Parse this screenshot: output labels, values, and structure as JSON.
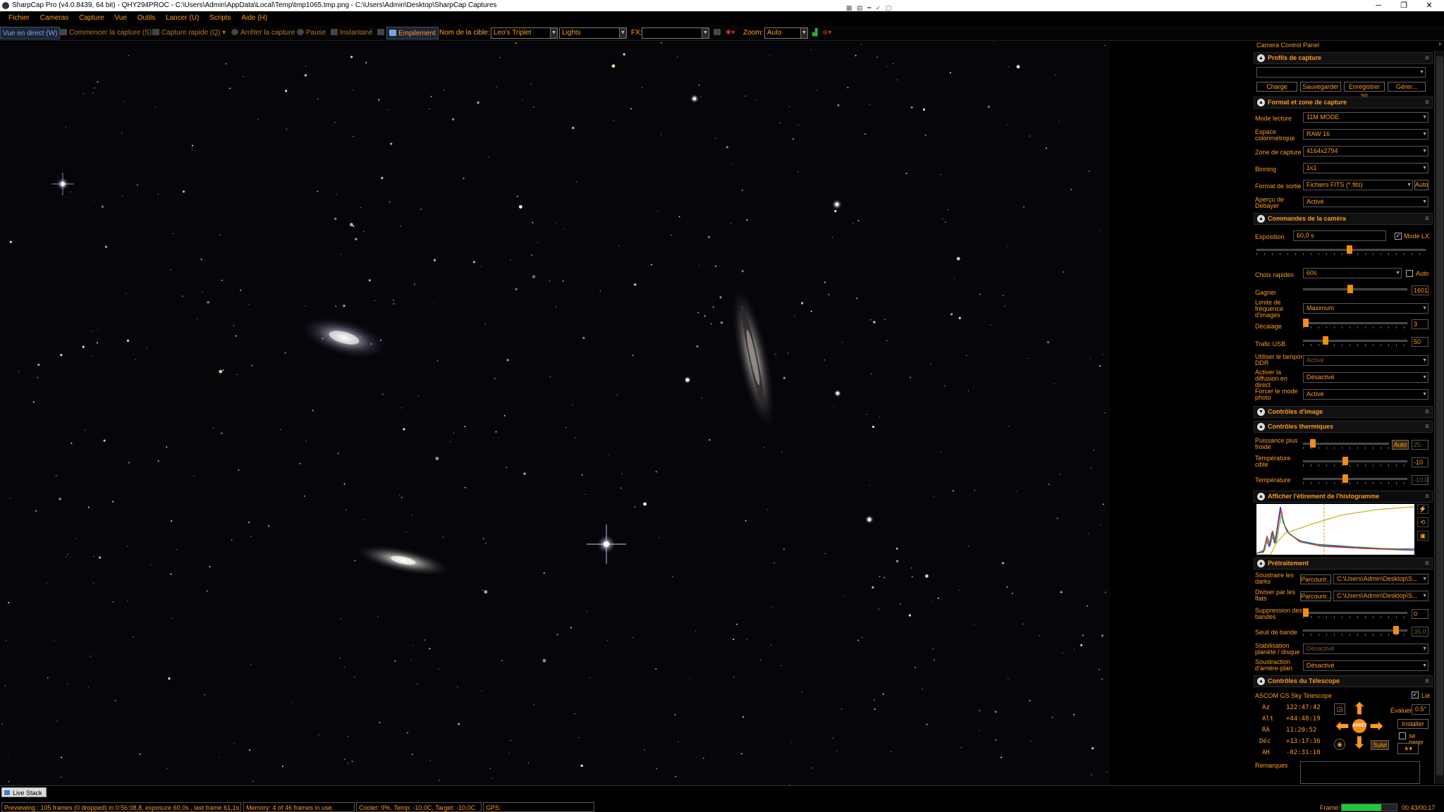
{
  "titlebar": {
    "title": "SharpCap Pro (v4.0.8439, 64 bit) - QHY294PROC - C:\\Users\\Admin\\AppData\\Local\\Temp\\tmp1065.tmp.png - C:\\Users\\Admin\\Desktop\\SharpCap Captures",
    "minimize": "─",
    "maximize": "❐",
    "close": "✕"
  },
  "menu": [
    "Fichier",
    "Cameras",
    "Capture",
    "Vue",
    "Outils",
    "Lancer (U)",
    "Scripts",
    "Aide (H)"
  ],
  "toolbar": {
    "live_view": "Vue en direct (W)",
    "start_capture": "Commencer la capture (S)",
    "quick_capture": "Capture rapide (Q)",
    "stop_capture": "Arrêter la capture",
    "pause": "Pause",
    "snapshot": "Instantané",
    "stacking": "Empilement",
    "target_label": "Nom de la cible:",
    "target_value": "Leo's Triplet",
    "type_value": "Lights",
    "fx_label": "FX:",
    "fx_value": "",
    "zoom_label": "Zoom:",
    "zoom_value": "Auto"
  },
  "panel": {
    "title": "Camera Control Panel",
    "pin": "ᵖ",
    "profiles": {
      "header": "Profils de capture",
      "value": "",
      "buttons": [
        "Charge",
        "Sauvegarder",
        "Enregistrer so",
        "Gérer..."
      ]
    },
    "format": {
      "header": "Format et zone de capture",
      "rows": [
        {
          "label": "Mode lecture",
          "value": "11M MODE"
        },
        {
          "label": "Espace colorimétrique",
          "value": "RAW 16"
        },
        {
          "label": "Zone de capture",
          "value": "4164x2794"
        },
        {
          "label": "Binning",
          "value": "1x1"
        },
        {
          "label": "Format de sortie",
          "value": "Fichiers FITS (*.fits)"
        },
        {
          "label": "Aperçu de Debayer",
          "value": "Activé"
        }
      ],
      "auto": "Auto"
    },
    "camera": {
      "header": "Commandes de la caméra",
      "exposure_label": "Exposition",
      "exposure_value": "60,0 s",
      "lx_label": "Mode LX",
      "quick_label": "Choix rapides",
      "quick_value": "60s",
      "auto_label": "Auto",
      "gain_label": "Gagner",
      "gain_value": "1601",
      "framerate_label": "Limite de fréquence d'images",
      "framerate_value": "Maximum",
      "offset_label": "Décalage",
      "offset_value": "3",
      "usb_label": "Trafic USB",
      "usb_value": "50",
      "ddr_label": "Utiliser le tampon DDR",
      "ddr_value": "Activé",
      "stream_label": "Activer la diffusion en direct",
      "stream_value": "Désactivé",
      "photo_label": "Forcer le mode photo",
      "photo_value": "Activé"
    },
    "image_controls": {
      "header": "Contrôles d'image"
    },
    "thermal": {
      "header": "Contrôles thermiques",
      "cooler_label": "Puissance plus froide",
      "cooler_auto": "Auto",
      "cooler_value": "25",
      "target_label": "Température cible",
      "target_value": "-10",
      "temp_label": "Température",
      "temp_value": "-10.0"
    },
    "histogram": {
      "header": "Afficher l'étirement de l'histogramme"
    },
    "preprocess": {
      "header": "Prétraitement",
      "darks_label": "Soustraire les darks",
      "darks_browse": "Parcourir...",
      "darks_value": "C:\\Users\\Admin\\Desktop\\S...",
      "flats_label": "Diviser par les flats",
      "flats_browse": "Parcourir...",
      "flats_value": "C:\\Users\\Admin\\Desktop\\S...",
      "banding_label": "Suppression des bandes",
      "banding_value": "0",
      "threshold_label": "Seuil de bande",
      "threshold_value": "35.0",
      "stab_label": "Stabilisation planète / disque",
      "stab_value": "Désactivé",
      "bg_label": "Soustraction d'arrière-plan",
      "bg_value": "Désactivé"
    },
    "telescope": {
      "header": "Contrôles du Télescope",
      "name": "ASCOM GS Sky Telescope",
      "linked_label": "Lié",
      "coords": [
        {
          "k": "Az",
          "v": "122:47:42"
        },
        {
          "k": "Alt",
          "v": "+44:48:19"
        },
        {
          "k": "RA",
          "v": "11:20:52"
        },
        {
          "k": "Déc",
          "v": "+13:17:36"
        },
        {
          "k": "AH",
          "v": "-02:31:10"
        }
      ],
      "rate_label": "Évaluer",
      "rate_value": "0.5°",
      "setup_label": "Installer",
      "park_label": "se garer",
      "track_label": "Suivi",
      "stop_label": "ARRÊT",
      "notes_label": "Remarques"
    }
  },
  "bottom": {
    "tab": "Live Stack",
    "status_preview": "Previewing : 105 frames (0 dropped) in 0:56:08,8, exposure 60,0s , last frame 61,1s",
    "status_memory": "Memory: 4 of 46 frames in use.",
    "status_cooler": "Cooler: 9%, Temp: -10,0C, Target: -10,0C",
    "status_gps": "GPS:",
    "frame_label": "Frame:",
    "frame_progress": 0.72,
    "frame_time": "00:43/00:17"
  },
  "colors": {
    "accent": "#ff9a1e",
    "slider": "#f28c14",
    "frame_green": "#1ec83a"
  }
}
